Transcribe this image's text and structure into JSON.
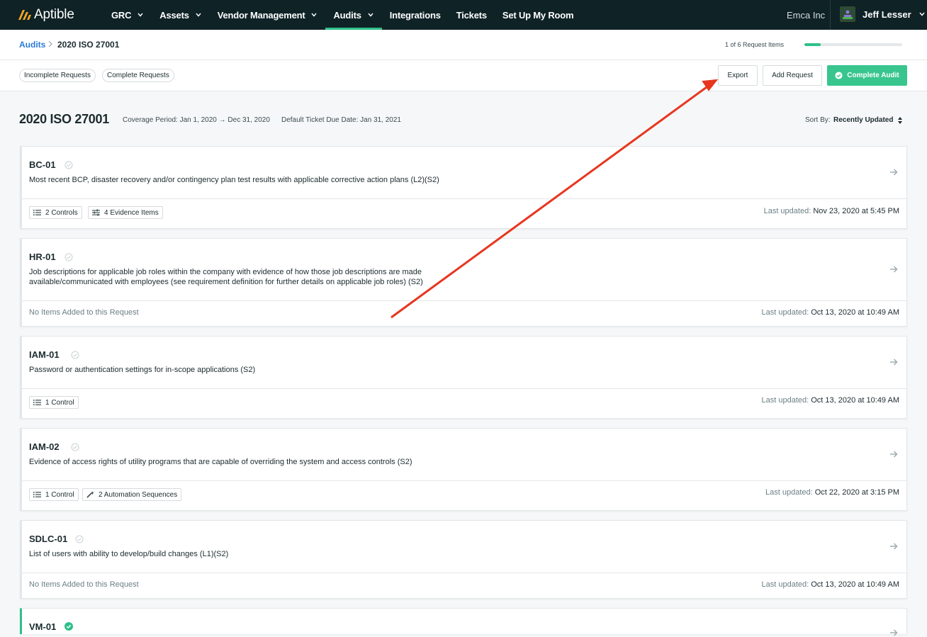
{
  "nav": {
    "logo": "Aptible",
    "items": [
      {
        "label": "GRC",
        "dropdown": true,
        "active": false
      },
      {
        "label": "Assets",
        "dropdown": true,
        "active": false
      },
      {
        "label": "Vendor Management",
        "dropdown": true,
        "active": false
      },
      {
        "label": "Audits",
        "dropdown": true,
        "active": true
      },
      {
        "label": "Integrations",
        "dropdown": false,
        "active": false
      },
      {
        "label": "Tickets",
        "dropdown": false,
        "active": false
      },
      {
        "label": "Set Up My Room",
        "dropdown": false,
        "active": false
      }
    ],
    "org": "Emca Inc",
    "user": "Jeff Lesser"
  },
  "breadcrumb": {
    "parent": "Audits",
    "current": "2020 ISO 27001"
  },
  "progress": {
    "text": "1 of 6 Request Items",
    "fraction": 0.167
  },
  "toolbar": {
    "filters": [
      "Incomplete Requests",
      "Complete Requests"
    ],
    "export": "Export",
    "add_request": "Add Request",
    "complete_audit": "Complete Audit"
  },
  "audit": {
    "title": "2020 ISO 27001",
    "coverage": "Coverage Period: Jan 1, 2020 → Dec 31, 2020",
    "due": "Default Ticket Due Date: Jan 31, 2021",
    "sort_label": "Sort By:",
    "sort_value": "Recently Updated"
  },
  "requests": [
    {
      "id": "BC-01",
      "complete": false,
      "desc": "Most recent BCP, disaster recovery and/or contingency plan test results with applicable corrective action plans (L2)(S2)",
      "tags": [
        {
          "icon": "list-icon",
          "label": "2 Controls"
        },
        {
          "icon": "sliders-icon",
          "label": "4 Evidence Items"
        }
      ],
      "empty": "",
      "updated_label": "Last updated:",
      "updated": "Nov 23, 2020 at 5:45 PM"
    },
    {
      "id": "HR-01",
      "complete": false,
      "desc": "Job descriptions for applicable job roles within the company with evidence of how those job descriptions are made available/communicated with employees (see requirement definition for further details on applicable job roles) (S2)",
      "tags": [],
      "empty": "No Items Added to this Request",
      "updated_label": "Last updated:",
      "updated": "Oct 13, 2020 at 10:49 AM"
    },
    {
      "id": "IAM-01",
      "complete": false,
      "desc": "Password or authentication settings for in-scope applications (S2)",
      "tags": [
        {
          "icon": "list-icon",
          "label": "1 Control"
        }
      ],
      "empty": "",
      "updated_label": "Last updated:",
      "updated": "Oct 13, 2020 at 10:49 AM"
    },
    {
      "id": "IAM-02",
      "complete": false,
      "desc": "Evidence of access rights of utility programs that are capable of overriding the system and access controls (S2)",
      "tags": [
        {
          "icon": "list-icon",
          "label": "1 Control"
        },
        {
          "icon": "wand-icon",
          "label": "2 Automation Sequences"
        }
      ],
      "empty": "",
      "updated_label": "Last updated:",
      "updated": "Oct 22, 2020 at 3:15 PM"
    },
    {
      "id": "SDLC-01",
      "complete": false,
      "desc": "List of users with ability to develop/build changes (L1)(S2)",
      "tags": [],
      "empty": "No Items Added to this Request",
      "updated_label": "Last updated:",
      "updated": "Oct 13, 2020 at 10:49 AM"
    },
    {
      "id": "VM-01",
      "complete": true,
      "desc": "",
      "tags": [],
      "empty": "",
      "updated_label": "",
      "updated": ""
    }
  ],
  "colors": {
    "nav_bg": "#0f2226",
    "accent": "#2fbf8a",
    "link": "#2b7bd6",
    "annotation_arrow": "#e8361f"
  }
}
